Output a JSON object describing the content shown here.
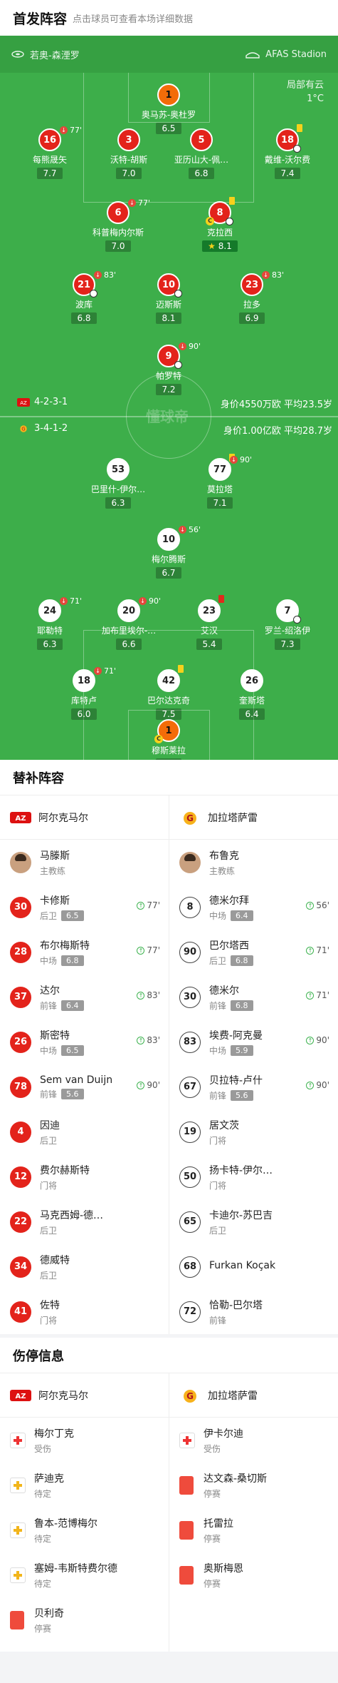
{
  "header": {
    "title": "首发阵容",
    "subtitle": "点击球员可查看本场详细数据"
  },
  "venue": {
    "team": "若奥-森湮罗",
    "stadium": "AFAS Stadion"
  },
  "weather": {
    "desc": "局部有云",
    "temp": "1°C"
  },
  "home_players": [
    {
      "num": "1",
      "name": "奥马苏-奥杜罗",
      "rating": "6.5",
      "kit": "gk"
    },
    {
      "num": "16",
      "name": "每熊晟矢",
      "rating": "7.7",
      "kit": "red",
      "sub": "77'"
    },
    {
      "num": "3",
      "name": "沃特-胡斯",
      "rating": "7.0",
      "kit": "red"
    },
    {
      "num": "5",
      "name": "亚历山大-佩…",
      "rating": "6.8",
      "kit": "red"
    },
    {
      "num": "18",
      "name": "戴维-沃尔费",
      "rating": "7.4",
      "kit": "red"
    },
    {
      "num": "6",
      "name": "科普梅内尔斯",
      "rating": "7.0",
      "kit": "red",
      "sub": "77'"
    },
    {
      "num": "8",
      "name": "克拉西",
      "rating": "8.1",
      "kit": "red"
    },
    {
      "num": "21",
      "name": "波库",
      "rating": "6.8",
      "kit": "red",
      "sub": "83'"
    },
    {
      "num": "10",
      "name": "迈斯斯",
      "rating": "8.1",
      "kit": "red"
    },
    {
      "num": "23",
      "name": "拉多",
      "rating": "6.9",
      "kit": "red",
      "sub": "83'"
    },
    {
      "num": "9",
      "name": "帕罗特",
      "rating": "7.2",
      "kit": "red",
      "sub": "90'"
    }
  ],
  "away_players": [
    {
      "num": "53",
      "name": "巴里什-伊尔…",
      "rating": "6.3",
      "kit": "white"
    },
    {
      "num": "77",
      "name": "莫拉塔",
      "rating": "7.1",
      "kit": "white",
      "sub": "90'"
    },
    {
      "num": "10",
      "name": "梅尔腾斯",
      "rating": "6.7",
      "kit": "white",
      "sub": "56'"
    },
    {
      "num": "24",
      "name": "耶勒特",
      "rating": "6.3",
      "kit": "white",
      "sub": "71'"
    },
    {
      "num": "20",
      "name": "加布里埃尔-…",
      "rating": "6.6",
      "kit": "white",
      "sub": "90'"
    },
    {
      "num": "23",
      "name": "艾汉",
      "rating": "5.4",
      "kit": "white"
    },
    {
      "num": "7",
      "name": "罗兰-绍洛伊",
      "rating": "7.3",
      "kit": "white"
    },
    {
      "num": "18",
      "name": "库特卢",
      "rating": "6.0",
      "kit": "white",
      "sub": "71'"
    },
    {
      "num": "42",
      "name": "巴尔达克奇",
      "rating": "7.5",
      "kit": "white"
    },
    {
      "num": "26",
      "name": "奎斯塔",
      "rating": "6.4",
      "kit": "white"
    },
    {
      "num": "1",
      "name": "穆斯莱拉",
      "rating": "6.7",
      "kit": "gk"
    }
  ],
  "formation": {
    "home": "4-2-3-1",
    "home_value": "身价4550万欧 平均23.5岁",
    "away": "3-4-1-2",
    "away_value": "身价1.00亿欧 平均28.7岁",
    "watermark": "懂球帝"
  },
  "subs_section": {
    "title": "替补阵容",
    "home_team": "阿尔克马尔",
    "away_team": "加拉塔萨雷",
    "home_coach": {
      "name": "马滕斯",
      "role": "主教练"
    },
    "away_coach": {
      "name": "布鲁克",
      "role": "主教练"
    },
    "home": [
      {
        "num": "30",
        "name": "卡修斯",
        "pos": "后卫",
        "rating": "6.5",
        "in": "77'"
      },
      {
        "num": "28",
        "name": "布尔梅斯特",
        "pos": "中场",
        "rating": "6.8",
        "in": "77'"
      },
      {
        "num": "37",
        "name": "达尔",
        "pos": "前锋",
        "rating": "6.4",
        "in": "83'"
      },
      {
        "num": "26",
        "name": "斯密特",
        "pos": "中场",
        "rating": "6.5",
        "in": "83'"
      },
      {
        "num": "78",
        "name": "Sem van Duijn",
        "pos": "前锋",
        "rating": "5.6",
        "in": "90'"
      },
      {
        "num": "4",
        "name": "因迪",
        "pos": "后卫"
      },
      {
        "num": "12",
        "name": "费尔赫斯特",
        "pos": "门将"
      },
      {
        "num": "22",
        "name": "马克西姆-德…",
        "pos": "后卫"
      },
      {
        "num": "34",
        "name": "德威特",
        "pos": "后卫"
      },
      {
        "num": "41",
        "name": "佐特",
        "pos": "门将"
      }
    ],
    "away": [
      {
        "num": "8",
        "name": "德米尔拜",
        "pos": "中场",
        "rating": "6.4",
        "in": "56'"
      },
      {
        "num": "90",
        "name": "巴尔塔西",
        "pos": "后卫",
        "rating": "6.8",
        "in": "71'"
      },
      {
        "num": "30",
        "name": "德米尔",
        "pos": "前锋",
        "rating": "6.8",
        "in": "71'"
      },
      {
        "num": "83",
        "name": "埃费-阿克曼",
        "pos": "中场",
        "rating": "5.9",
        "in": "90'"
      },
      {
        "num": "67",
        "name": "贝拉特-卢什",
        "pos": "前锋",
        "rating": "5.6",
        "in": "90'"
      },
      {
        "num": "19",
        "name": "居文茨",
        "pos": "门将"
      },
      {
        "num": "50",
        "name": "扬卡特-伊尔…",
        "pos": "门将"
      },
      {
        "num": "65",
        "name": "卡迪尔-苏巴吉",
        "pos": "后卫"
      },
      {
        "num": "68",
        "name": "Furkan Koçak",
        "pos": ""
      },
      {
        "num": "72",
        "name": "恰勒-巴尔塔",
        "pos": "前锋"
      }
    ]
  },
  "injury_section": {
    "title": "伤停信息",
    "home_team": "阿尔克马尔",
    "away_team": "加拉塔萨雷",
    "home": [
      {
        "name": "梅尔丁克",
        "status": "受伤",
        "type": "injury"
      },
      {
        "name": "萨迪克",
        "status": "待定",
        "type": "doubt"
      },
      {
        "name": "鲁本-范博梅尔",
        "status": "待定",
        "type": "doubt"
      },
      {
        "name": "塞姆-韦斯特费尔德",
        "status": "待定",
        "type": "doubt"
      },
      {
        "name": "贝利奇",
        "status": "停赛",
        "type": "suspend"
      }
    ],
    "away": [
      {
        "name": "伊卡尔迪",
        "status": "受伤",
        "type": "injury"
      },
      {
        "name": "达文森-桑切斯",
        "status": "停赛",
        "type": "suspend"
      },
      {
        "name": "托雷拉",
        "status": "停赛",
        "type": "suspend"
      },
      {
        "name": "奥斯梅恩",
        "status": "停赛",
        "type": "suspend"
      }
    ]
  }
}
